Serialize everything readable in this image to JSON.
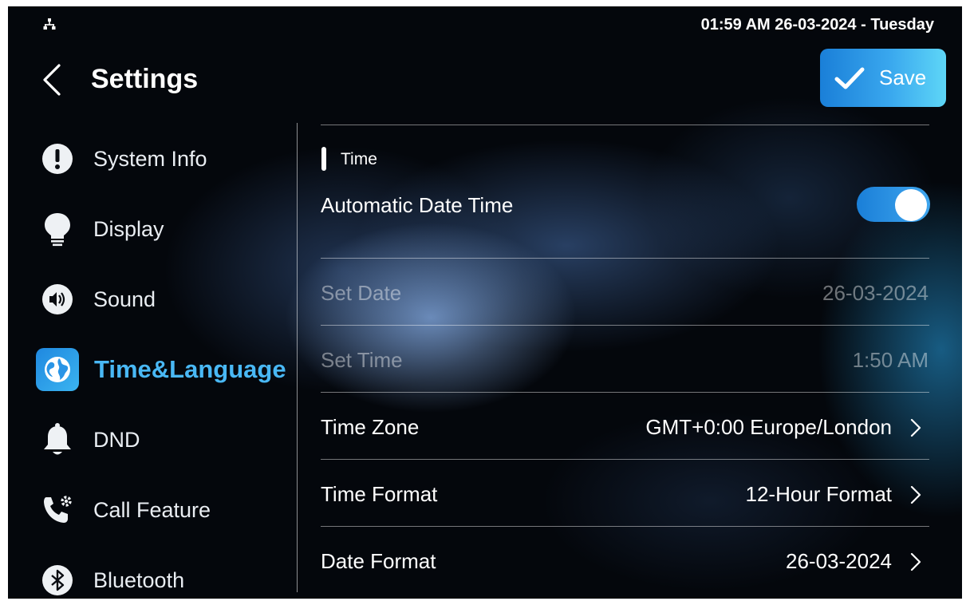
{
  "status_bar": {
    "clock": "01:59 AM  26-03-2024 - Tuesday"
  },
  "header": {
    "title": "Settings",
    "save_label": "Save"
  },
  "sidebar": {
    "items": [
      {
        "label": "System Info",
        "icon": "info-exclamation-icon"
      },
      {
        "label": "Display",
        "icon": "lightbulb-icon"
      },
      {
        "label": "Sound",
        "icon": "speaker-icon"
      },
      {
        "label": "Time&Language",
        "icon": "globe-icon",
        "active": true
      },
      {
        "label": "DND",
        "icon": "bell-icon"
      },
      {
        "label": "Call Feature",
        "icon": "phone-gear-icon"
      },
      {
        "label": "Bluetooth",
        "icon": "bluetooth-icon"
      }
    ]
  },
  "main": {
    "section_title": "Time",
    "automatic": {
      "label": "Automatic Date Time",
      "enabled": true
    },
    "set_date": {
      "label": "Set Date",
      "value": "26-03-2024"
    },
    "set_time": {
      "label": "Set Time",
      "value": "1:50 AM"
    },
    "time_zone": {
      "label": "Time Zone",
      "value": "GMT+0:00 Europe/London"
    },
    "time_format": {
      "label": "Time Format",
      "value": "12-Hour Format"
    },
    "date_format": {
      "label": "Date Format",
      "value": "26-03-2024"
    }
  },
  "colors": {
    "accent": "#1a7fd8",
    "active_text": "#49b8f5",
    "background": "#04070c"
  }
}
